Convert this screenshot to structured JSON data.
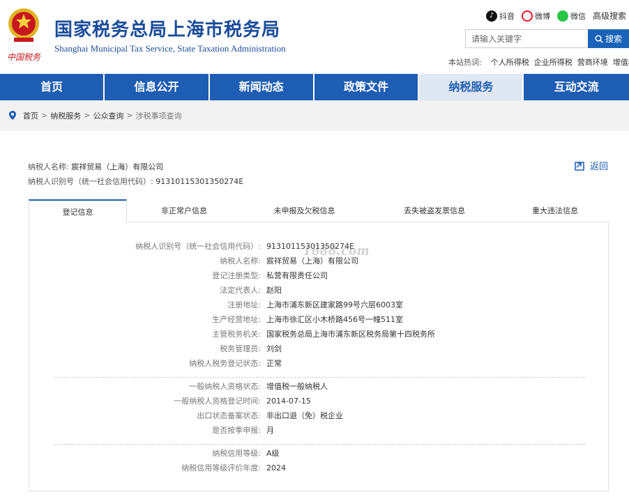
{
  "header": {
    "title": "国家税务总局上海市税务局",
    "subtitle": "Shanghai Municipal Tax Service, State Taxation Administration",
    "social": [
      {
        "icon": "douyin-icon",
        "label": "抖音"
      },
      {
        "icon": "weibo-icon",
        "label": "微博"
      },
      {
        "icon": "wechat-icon",
        "label": "微信"
      }
    ],
    "advanced_search": "高级搜索",
    "search_placeholder": "请输入关键字",
    "search_button": "搜索",
    "hot_label": "本站热词:",
    "hot_words": [
      "个人所得税",
      "企业所得税",
      "营商环境",
      "增值税"
    ]
  },
  "nav": {
    "tabs": [
      "首页",
      "信息公开",
      "新闻动态",
      "政策文件",
      "纳税服务",
      "互动交流"
    ],
    "active": "纳税服务"
  },
  "breadcrumb": {
    "items": [
      "首页",
      "纳税服务",
      "公众查询"
    ],
    "current": "涉税事项查询"
  },
  "taxpayer": {
    "name_label": "纳税人名称:",
    "name": "宸祥贸易（上海）有限公司",
    "id_label": "纳税人识别号（统一社会信用代码）:",
    "id": "91310115301350274E"
  },
  "back_label": "返回",
  "tabs": [
    "登记信息",
    "非正常户信息",
    "未申报及欠税信息",
    "丢失被盗发票信息",
    "重大违法信息"
  ],
  "active_tab": "登记信息",
  "section1": [
    {
      "label": "纳税人识别号（统一社会信用代码）:",
      "value": "91310115301350274E"
    },
    {
      "label": "纳税人名称:",
      "value": "宸祥贸易（上海）有限公司"
    },
    {
      "label": "登记注册类型:",
      "value": "私营有限责任公司"
    },
    {
      "label": "法定代表人:",
      "value": "赵阳"
    },
    {
      "label": "注册地址:",
      "value": "上海市浦东新区建家路99号六层6003室"
    },
    {
      "label": "生产经营地址:",
      "value": "上海市徐汇区小木桥路456号一幢511室"
    },
    {
      "label": "主管税务机关:",
      "value": "国家税务总局上海市浦东新区税务局第十四税务所"
    },
    {
      "label": "税务管理员:",
      "value": "刘剑"
    },
    {
      "label": "纳税人税务登记状态:",
      "value": "正常"
    }
  ],
  "section2": [
    {
      "label": "一般纳税人资格状态:",
      "value": "增值税一般纳税人"
    },
    {
      "label": "一般纳税人资格登记时间:",
      "value": "2014-07-15"
    },
    {
      "label": "出口状态备案状态:",
      "value": "非出口退（免）税企业"
    },
    {
      "label": "是否按季申报:",
      "value": "月"
    }
  ],
  "section3": [
    {
      "label": "纳税信用等级:",
      "value": "A级"
    },
    {
      "label": "纳税信用等级评价年度:",
      "value": "2024"
    }
  ],
  "watermark": "1688.com",
  "colors": {
    "brand_blue": "#1d5db3",
    "title_blue": "#1a4c9a",
    "emblem_red": "#c8161d",
    "emblem_gold": "#e0b422"
  }
}
